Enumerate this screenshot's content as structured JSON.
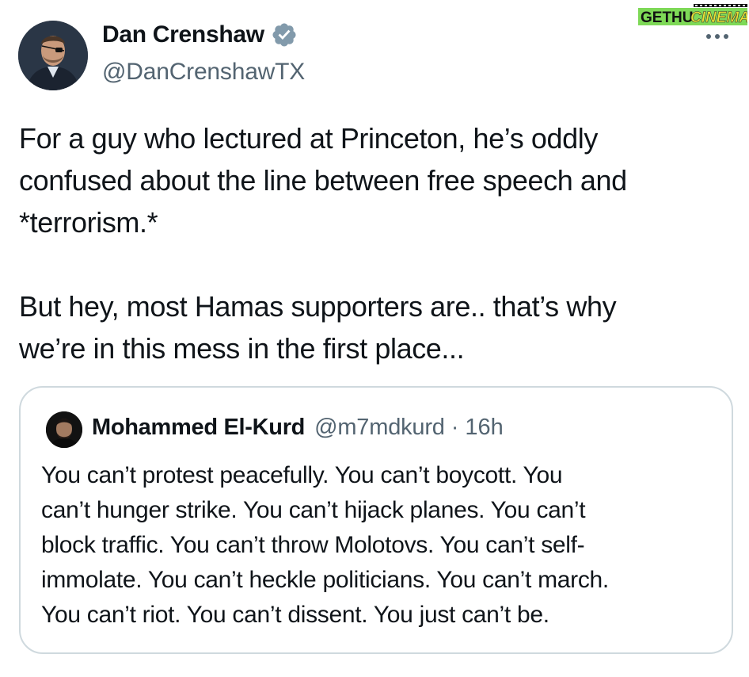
{
  "watermark": {
    "text_left": "GETHU",
    "text_right": "CINEMA",
    "left_color": "#111111",
    "right_color": "#e8e233",
    "background": "#7ed957"
  },
  "more_icon": "more-horizontal-icon",
  "author": {
    "name": "Dan Crenshaw",
    "handle": "@DanCrenshawTX",
    "verified_icon": "verified-badge-icon",
    "verified_color": "#829aab"
  },
  "tweet": {
    "text": "For a guy who lectured at Princeton, he’s oddly\nconfused about the line between free speech and\n*terrorism.*\n\nBut hey, most Hamas supporters are.. that’s why\nwe’re in this mess in the first place..."
  },
  "quote": {
    "name": "Mohammed El-Kurd",
    "handle": "@m7mdkurd",
    "separator": "·",
    "time": "16h",
    "text": "You can’t protest peacefully. You can’t boycott. You\ncan’t hunger strike. You can’t hijack planes. You can’t\nblock traffic. You can’t throw Molotovs. You can’t self-\nimmolate. You can’t heckle politicians. You can’t march.\nYou can’t riot. You can’t dissent. You just can’t be."
  }
}
